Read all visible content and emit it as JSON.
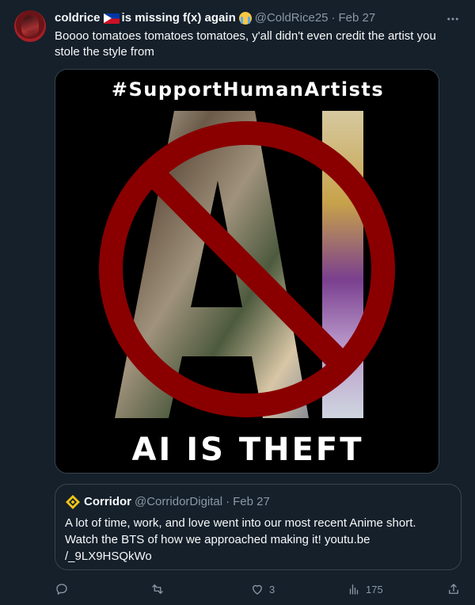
{
  "author": {
    "display_name": "coldrice",
    "name_suffix": "is missing f(x) again",
    "handle": "@ColdRice25",
    "date": "Feb 27"
  },
  "tweet_text": "Boooo tomatoes tomatoes tomatoes, y'all didn't even credit the artist you stole the style from",
  "media": {
    "top_text": "#SupportHumanArtists",
    "bottom_text": "AI IS THEFT",
    "big_letters": "AI",
    "colors": {
      "prohibition": "#8a0000",
      "background": "#000000",
      "text": "#ffffff"
    }
  },
  "quoted": {
    "display_name": "Corridor",
    "handle": "@CorridorDigital",
    "date": "Feb 27",
    "text": "A lot of time, work, and love went into our most recent Anime short. Watch the BTS of how we approached making it! youtu.be /_9LX9HSQkWo"
  },
  "actions": {
    "reply_count": "",
    "retweet_count": "",
    "like_count": "3",
    "views_count": "175"
  },
  "icons": [
    "more-icon",
    "reply-icon",
    "retweet-icon",
    "like-icon",
    "views-icon",
    "share-icon",
    "corridor-logo-icon"
  ],
  "theme": {
    "background": "#15202b",
    "text": "#f7f9f9",
    "muted": "#8b98a5",
    "border": "#38444d"
  }
}
